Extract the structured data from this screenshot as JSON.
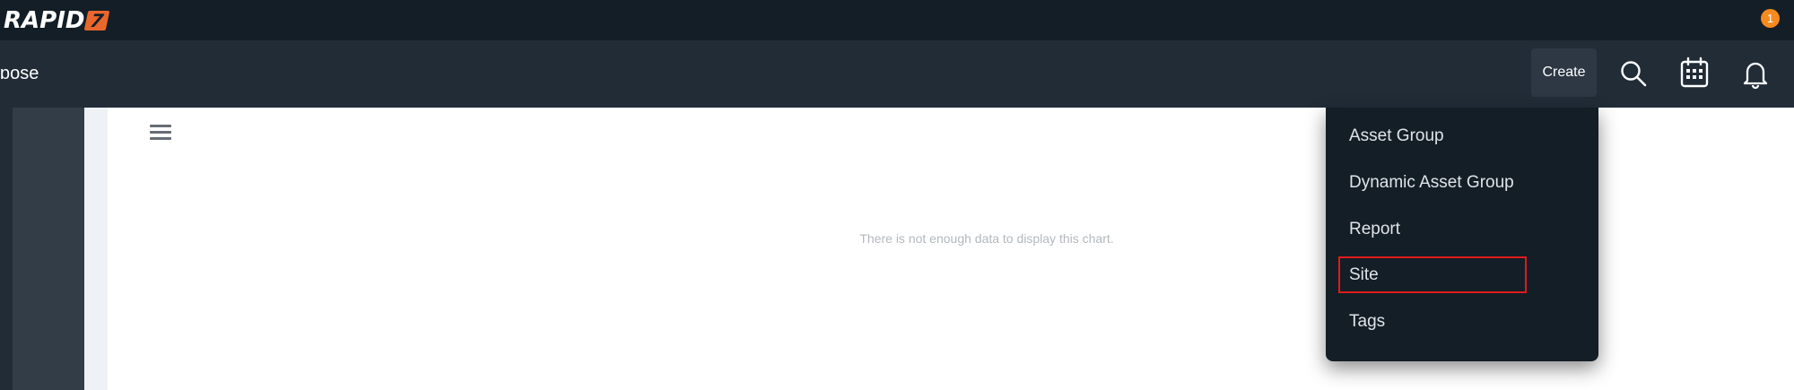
{
  "brand": {
    "logo_text": "RAPID",
    "logo_mark": "7",
    "logo_accent": "#e9672c"
  },
  "header": {
    "app_name": "ɒose",
    "create_label": "Create",
    "notification_count": "1",
    "icons": [
      "search-icon",
      "calendar-icon",
      "bell-icon"
    ]
  },
  "main": {
    "empty_message": "There is not enough data to display this chart."
  },
  "create_menu": {
    "items": [
      {
        "label": "Asset Group"
      },
      {
        "label": "Dynamic Asset Group"
      },
      {
        "label": "Report"
      },
      {
        "label": "Site",
        "highlighted": true
      },
      {
        "label": "Tags"
      }
    ]
  },
  "colors": {
    "topbar": "#141e27",
    "navbar": "#212c37",
    "badge": "#f58a1f",
    "highlight": "#e01b1b"
  }
}
